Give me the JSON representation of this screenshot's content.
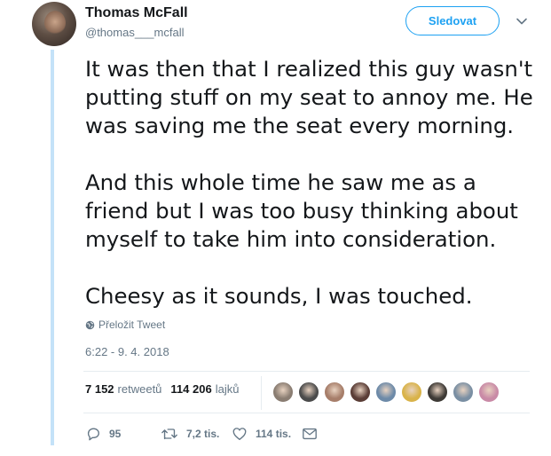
{
  "tweet": {
    "author_name": "Thomas McFall",
    "author_handle": "@thomas___mcfall",
    "follow_label": "Sledovat",
    "lines_1": [
      "It was then that I realized this guy wasn't",
      "putting stuff on my seat to annoy me. He",
      "was saving me the seat every morning."
    ],
    "lines_2": [
      "And this whole time he saw me as a",
      "friend but I was too busy thinking about",
      "myself to take him into consideration."
    ],
    "lines_3": [
      "Cheesy as it sounds, I was touched."
    ],
    "translate_label": "Přeložit Tweet",
    "timestamp": "6:22 - 9. 4. 2018"
  },
  "stats": {
    "retweets_count": "7 152",
    "retweets_label": "retweetů",
    "likes_count": "114 206",
    "likes_label": "lajků"
  },
  "liker_avatar_colors": [
    "#8a7d72",
    "#4b4b4b",
    "#a77e6a",
    "#5a3d36",
    "#6d8aa8",
    "#d9b34a",
    "#3e3a36",
    "#7a8fa3",
    "#c98aa6"
  ],
  "actions": {
    "reply_count": "95",
    "retweet_count": "7,2 tis.",
    "like_count": "114 tis."
  },
  "colors": {
    "accent": "#1da1f2",
    "thread_line": "#c4e2f8",
    "muted": "#657786"
  },
  "icons": [
    "chevron-down-icon",
    "globe-icon",
    "reply-icon",
    "retweet-icon",
    "heart-icon",
    "message-icon"
  ]
}
